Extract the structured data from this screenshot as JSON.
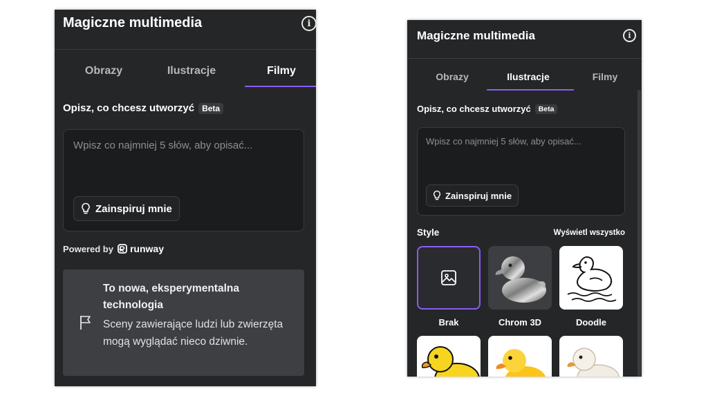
{
  "left_panel": {
    "title": "Magiczne multimedia",
    "tabs": [
      {
        "label": "Obrazy",
        "active": false
      },
      {
        "label": "Ilustracje",
        "active": false
      },
      {
        "label": "Filmy",
        "active": true
      }
    ],
    "describe_label": "Opisz, co chcesz utworzyć",
    "beta_badge": "Beta",
    "prompt_placeholder": "Wpisz co najmniej 5 słów, aby opisać...",
    "inspire_button": "Zainspiruj mnie",
    "powered_by": "Powered by",
    "runway_brand": "runway",
    "notice": {
      "title": "To nowa, eksperymentalna technologia",
      "body": "Sceny zawierające ludzi lub zwierzęta mogą wyglądać nieco dziwnie."
    }
  },
  "right_panel": {
    "title": "Magiczne multimedia",
    "tabs": [
      {
        "label": "Obrazy",
        "active": false
      },
      {
        "label": "Ilustracje",
        "active": true
      },
      {
        "label": "Filmy",
        "active": false
      }
    ],
    "describe_label": "Opisz, co chcesz utworzyć",
    "beta_badge": "Beta",
    "prompt_placeholder": "Wpisz co najmniej 5 słów, aby opisać...",
    "inspire_button": "Zainspiruj mnie",
    "styles_title": "Style",
    "view_all": "Wyświetl wszystko",
    "styles": [
      {
        "label": "Brak",
        "selected": true,
        "icon": "image-icon"
      },
      {
        "label": "Chrom 3D",
        "selected": false,
        "icon": "chrome-duck-thumbnail"
      },
      {
        "label": "Doodle",
        "selected": false,
        "icon": "doodle-duck-thumbnail"
      }
    ]
  },
  "colors": {
    "panel_bg": "#252627",
    "accent": "#8b5cf6",
    "input_bg": "#1b1c1d",
    "notice_bg": "#3e3f43"
  }
}
